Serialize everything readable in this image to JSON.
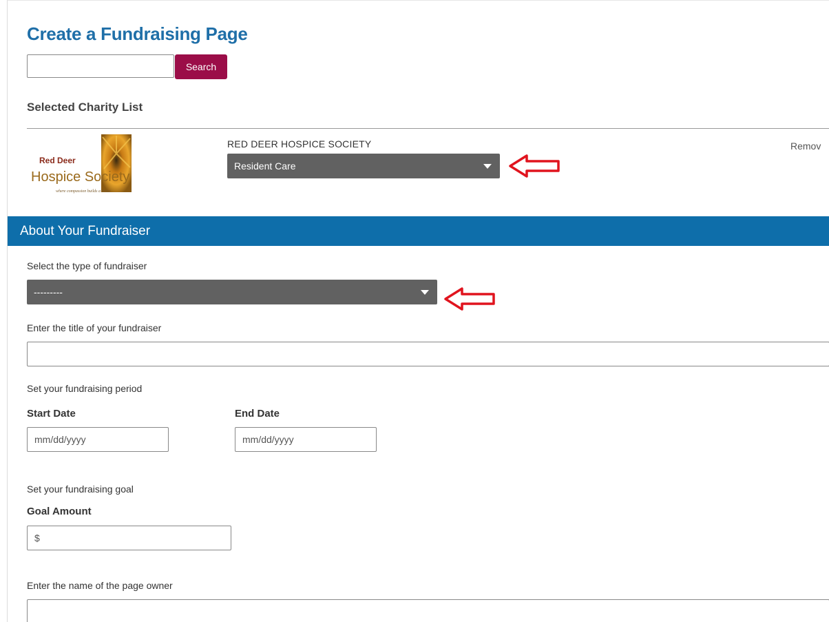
{
  "page": {
    "title": "Create a Fundraising Page"
  },
  "search": {
    "value": "",
    "button_label": "Search"
  },
  "selected_charity": {
    "heading": "Selected Charity List",
    "logo": {
      "line1": "Red Deer",
      "line2": "Hospice Society",
      "tagline": "where compassion builds a home"
    },
    "name": "RED DEER HOSPICE SOCIETY",
    "fund_selected": "Resident Care",
    "remove_label": "Remov"
  },
  "about": {
    "banner": "About Your Fundraiser",
    "type_label": "Select the type of fundraiser",
    "type_selected": "---------",
    "title_label": "Enter the title of your fundraiser",
    "title_value": "",
    "period_label": "Set your fundraising period",
    "start_label": "Start Date",
    "start_placeholder": "mm/dd/yyyy",
    "end_label": "End Date",
    "end_placeholder": "mm/dd/yyyy",
    "goal_section_label": "Set your fundraising goal",
    "goal_label": "Goal Amount",
    "goal_prefix": "$",
    "owner_label": "Enter the name of the page owner",
    "owner_value": ""
  },
  "colors": {
    "title_blue": "#1f6fa8",
    "banner_blue": "#0e6eaa",
    "search_button": "#9b0d48",
    "select_gray": "#616161",
    "annotation_red": "#e0141e"
  },
  "icons": [
    "caret-down-icon",
    "left-arrow-annotation-icon"
  ]
}
